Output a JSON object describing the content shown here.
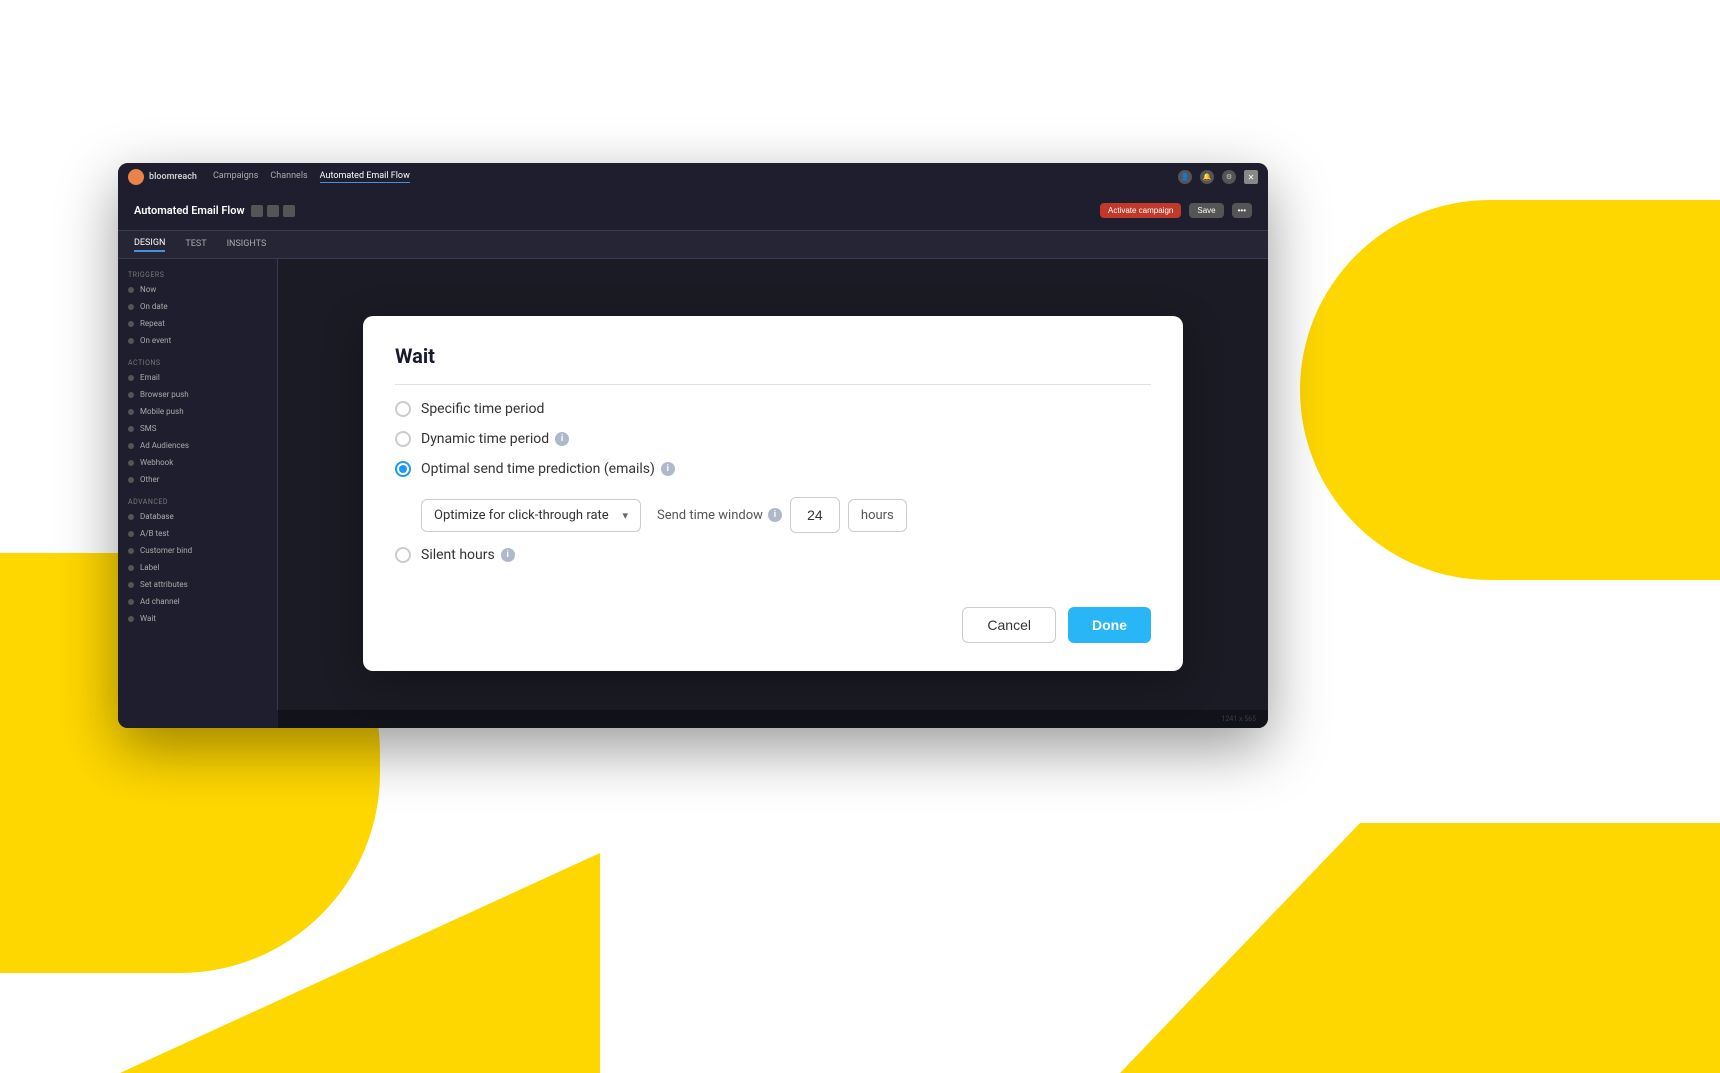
{
  "app": {
    "title": "Automated Email Flow",
    "logo_text": "bloomreach",
    "nav_tabs": [
      {
        "label": "Campaigns",
        "active": false
      },
      {
        "label": "Channels",
        "active": false
      },
      {
        "label": "Automated Email Flow",
        "active": true
      }
    ],
    "sub_nav_tabs": [
      {
        "label": "DESIGN",
        "active": true
      },
      {
        "label": "TEST",
        "active": false
      },
      {
        "label": "INSIGHTS",
        "active": false
      }
    ],
    "header_buttons": {
      "activate": "Activate campaign",
      "save": "Save",
      "more": "•••"
    }
  },
  "sidebar": {
    "triggers_title": "Triggers",
    "trigger_items": [
      {
        "label": "Now"
      },
      {
        "label": "On date"
      },
      {
        "label": "Repeat"
      },
      {
        "label": "On event"
      }
    ],
    "actions_title": "Actions",
    "action_items": [
      {
        "label": "Email"
      },
      {
        "label": "Browser push"
      },
      {
        "label": "Mobile push"
      },
      {
        "label": "SMS"
      },
      {
        "label": "Ad Audiences"
      },
      {
        "label": "Webhook"
      },
      {
        "label": "Other"
      }
    ],
    "advanced_title": "Advanced",
    "advanced_items": [
      {
        "label": "Database"
      },
      {
        "label": "A/B test"
      },
      {
        "label": "Customer bind"
      },
      {
        "label": "Label"
      },
      {
        "label": "Set attributes"
      },
      {
        "label": "Ad channel"
      },
      {
        "label": "Wait"
      }
    ]
  },
  "modal": {
    "title": "Wait",
    "divider": true,
    "options": [
      {
        "id": "specific_time",
        "label": "Specific time period",
        "checked": false,
        "has_info": false
      },
      {
        "id": "dynamic_time",
        "label": "Dynamic time period",
        "checked": false,
        "has_info": true
      },
      {
        "id": "optimal_send",
        "label": "Optimal send time prediction (emails)",
        "checked": true,
        "has_info": true
      }
    ],
    "dropdown": {
      "label": "Optimize for click-through rate",
      "value": "Optimize for click-through rate"
    },
    "send_time_window": {
      "label": "Send time window",
      "value": "24",
      "unit": "hours"
    },
    "silent_hours": {
      "label": "Silent hours",
      "checked": false,
      "has_info": true
    },
    "buttons": {
      "cancel": "Cancel",
      "done": "Done"
    }
  },
  "bottom_bar": {
    "text": "1241 x 565"
  },
  "colors": {
    "accent_blue": "#29b6f6",
    "radio_active": "#2196f3",
    "danger": "#c0392b",
    "bg_dark": "#2d2d3e",
    "bg_darker": "#1e1e2e",
    "yellow": "#FFD700"
  }
}
